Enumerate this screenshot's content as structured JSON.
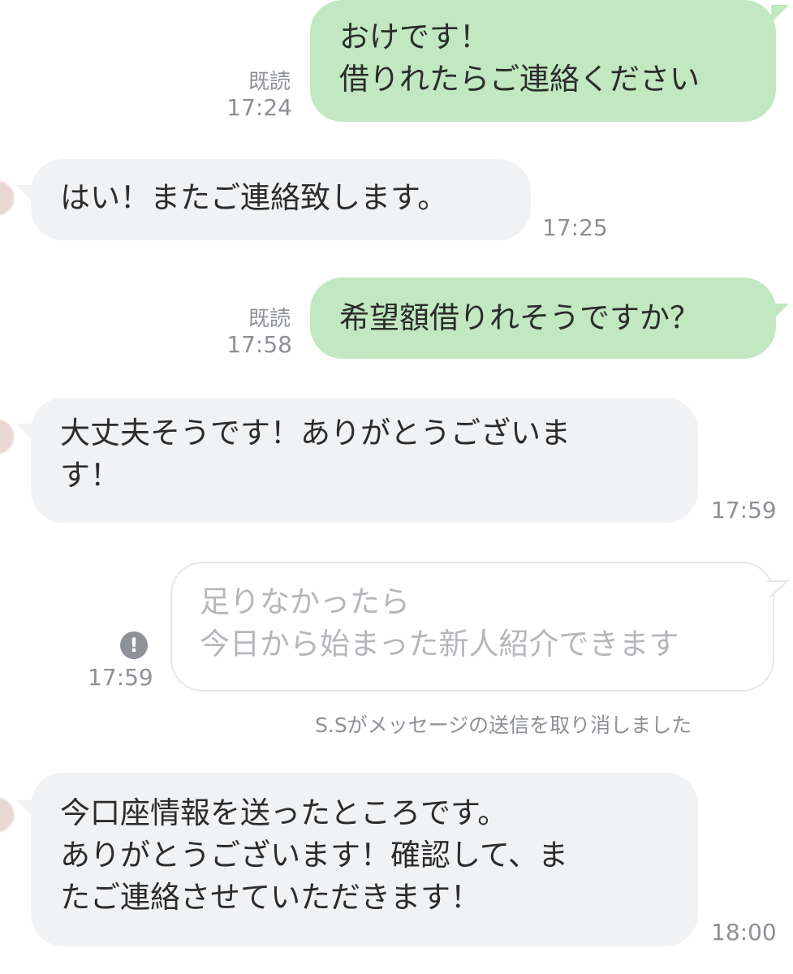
{
  "messages": [
    {
      "id": "m1",
      "lines": "おけです！\n借りれたらご連絡ください",
      "read_label": "既読",
      "time": "17:24"
    },
    {
      "id": "m2",
      "lines": "はい！またご連絡致します。",
      "time": "17:25"
    },
    {
      "id": "m3",
      "lines": "希望額借りれそうですか？",
      "read_label": "既読",
      "time": "17:58"
    },
    {
      "id": "m4",
      "lines": "大丈夫そうです！ありがとうございま\nす！",
      "time": "17:59"
    },
    {
      "id": "m5",
      "lines": "足りなかったら\n今日から始まった新人紹介できます",
      "time": "17:59",
      "error_icon": "!"
    },
    {
      "id": "m6",
      "lines": "今口座情報を送ったところです。\nありがとうございます！確認して、ま\nたご連絡させていただきます！",
      "time": "18:00"
    }
  ],
  "system_notice": "S.Sがメッセージの送信を取り消しました",
  "colors": {
    "outgoing_bubble": "#c1e8c0",
    "incoming_bubble": "#f1f2f4",
    "meta_text": "#8d9095"
  },
  "icons": {
    "send_error": "exclamation-circle-icon",
    "avatar": "avatar-partial"
  }
}
